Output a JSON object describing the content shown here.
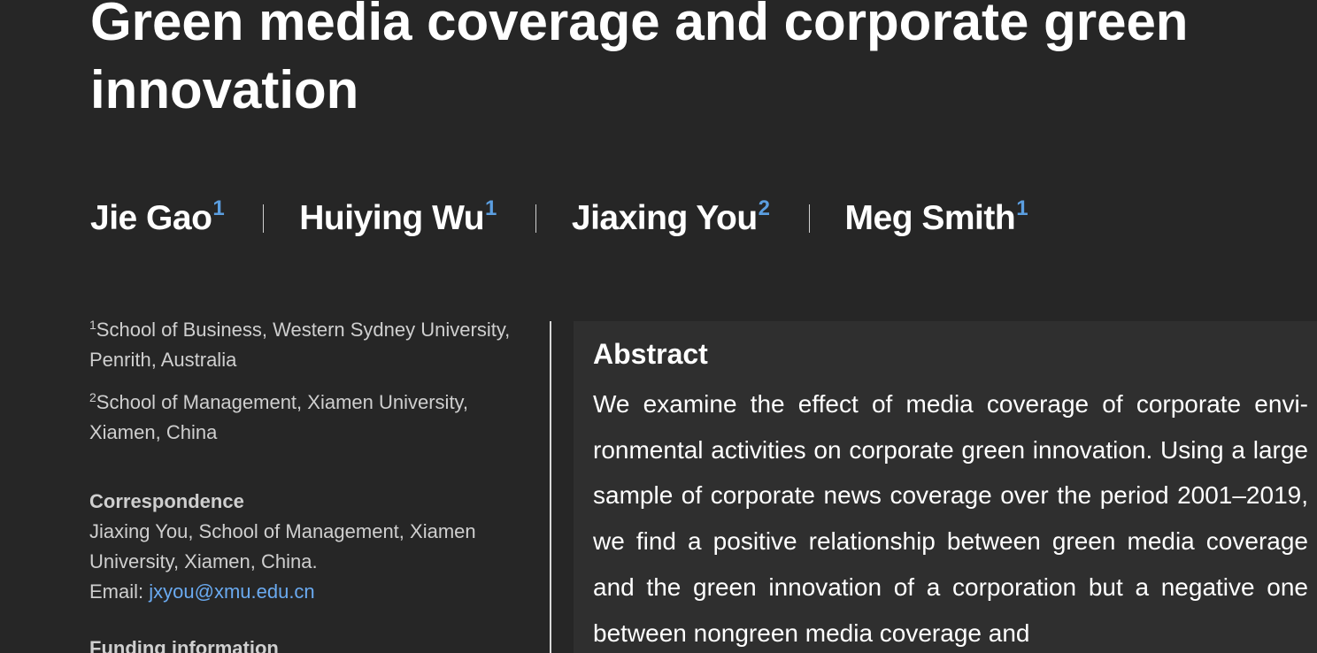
{
  "title": "Green media coverage and corporate green innovation",
  "authors": [
    {
      "name": "Jie Gao",
      "aff": "1"
    },
    {
      "name": "Huiying Wu",
      "aff": "1"
    },
    {
      "name": "Jiaxing You",
      "aff": "2"
    },
    {
      "name": "Meg Smith",
      "aff": "1"
    }
  ],
  "affiliations": [
    {
      "num": "1",
      "text": "School of Business, Western Sydney University, Penrith, Australia"
    },
    {
      "num": "2",
      "text": "School of Management, Xiamen University, Xiamen, China"
    }
  ],
  "correspondence": {
    "heading": "Correspondence",
    "text": "Jiaxing You, School of Management, Xiamen University, Xiamen, China.",
    "email_label": "Email: ",
    "email": "jxyou@xmu.edu.cn"
  },
  "funding": {
    "heading": "Funding information"
  },
  "abstract": {
    "heading": "Abstract",
    "text": "We examine the effect of media coverage of corporate envi­ronmental activities on corporate green innovation. Using a large sample of corporate news coverage over the period 2001–2019, we find a positive relationship between green media coverage and the green innovation of a corporation but a negative one between nongreen media coverage and"
  },
  "colors": {
    "background": "#262626",
    "abstract_panel": "#2f2f2f",
    "accent_link": "#6aaaf0",
    "superscript": "#5b9ee0"
  }
}
